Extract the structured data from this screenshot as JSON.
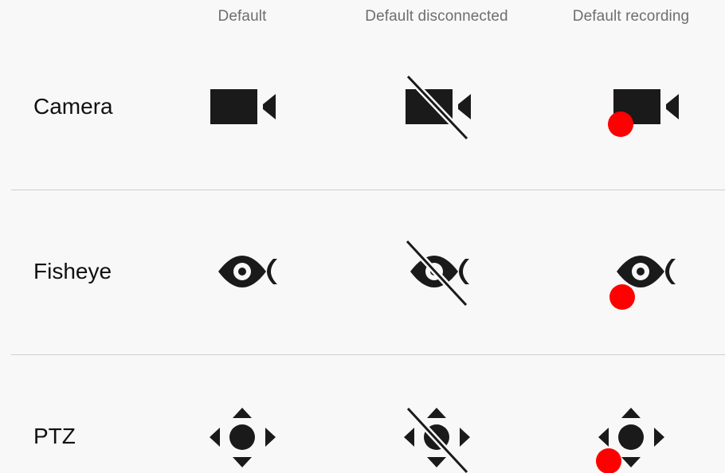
{
  "columns": [
    {
      "label": "Default"
    },
    {
      "label": "Default disconnected"
    },
    {
      "label": "Default recording"
    }
  ],
  "rows": [
    {
      "label": "Camera",
      "icon": "video-camera-icon"
    },
    {
      "label": "Fisheye",
      "icon": "fisheye-icon"
    },
    {
      "label": "PTZ",
      "icon": "ptz-icon"
    }
  ],
  "colors": {
    "icon": "#1a1a1a",
    "recording_dot": "#ff0000",
    "divider": "#cfcfcf",
    "header_text": "#6e6e6e"
  }
}
